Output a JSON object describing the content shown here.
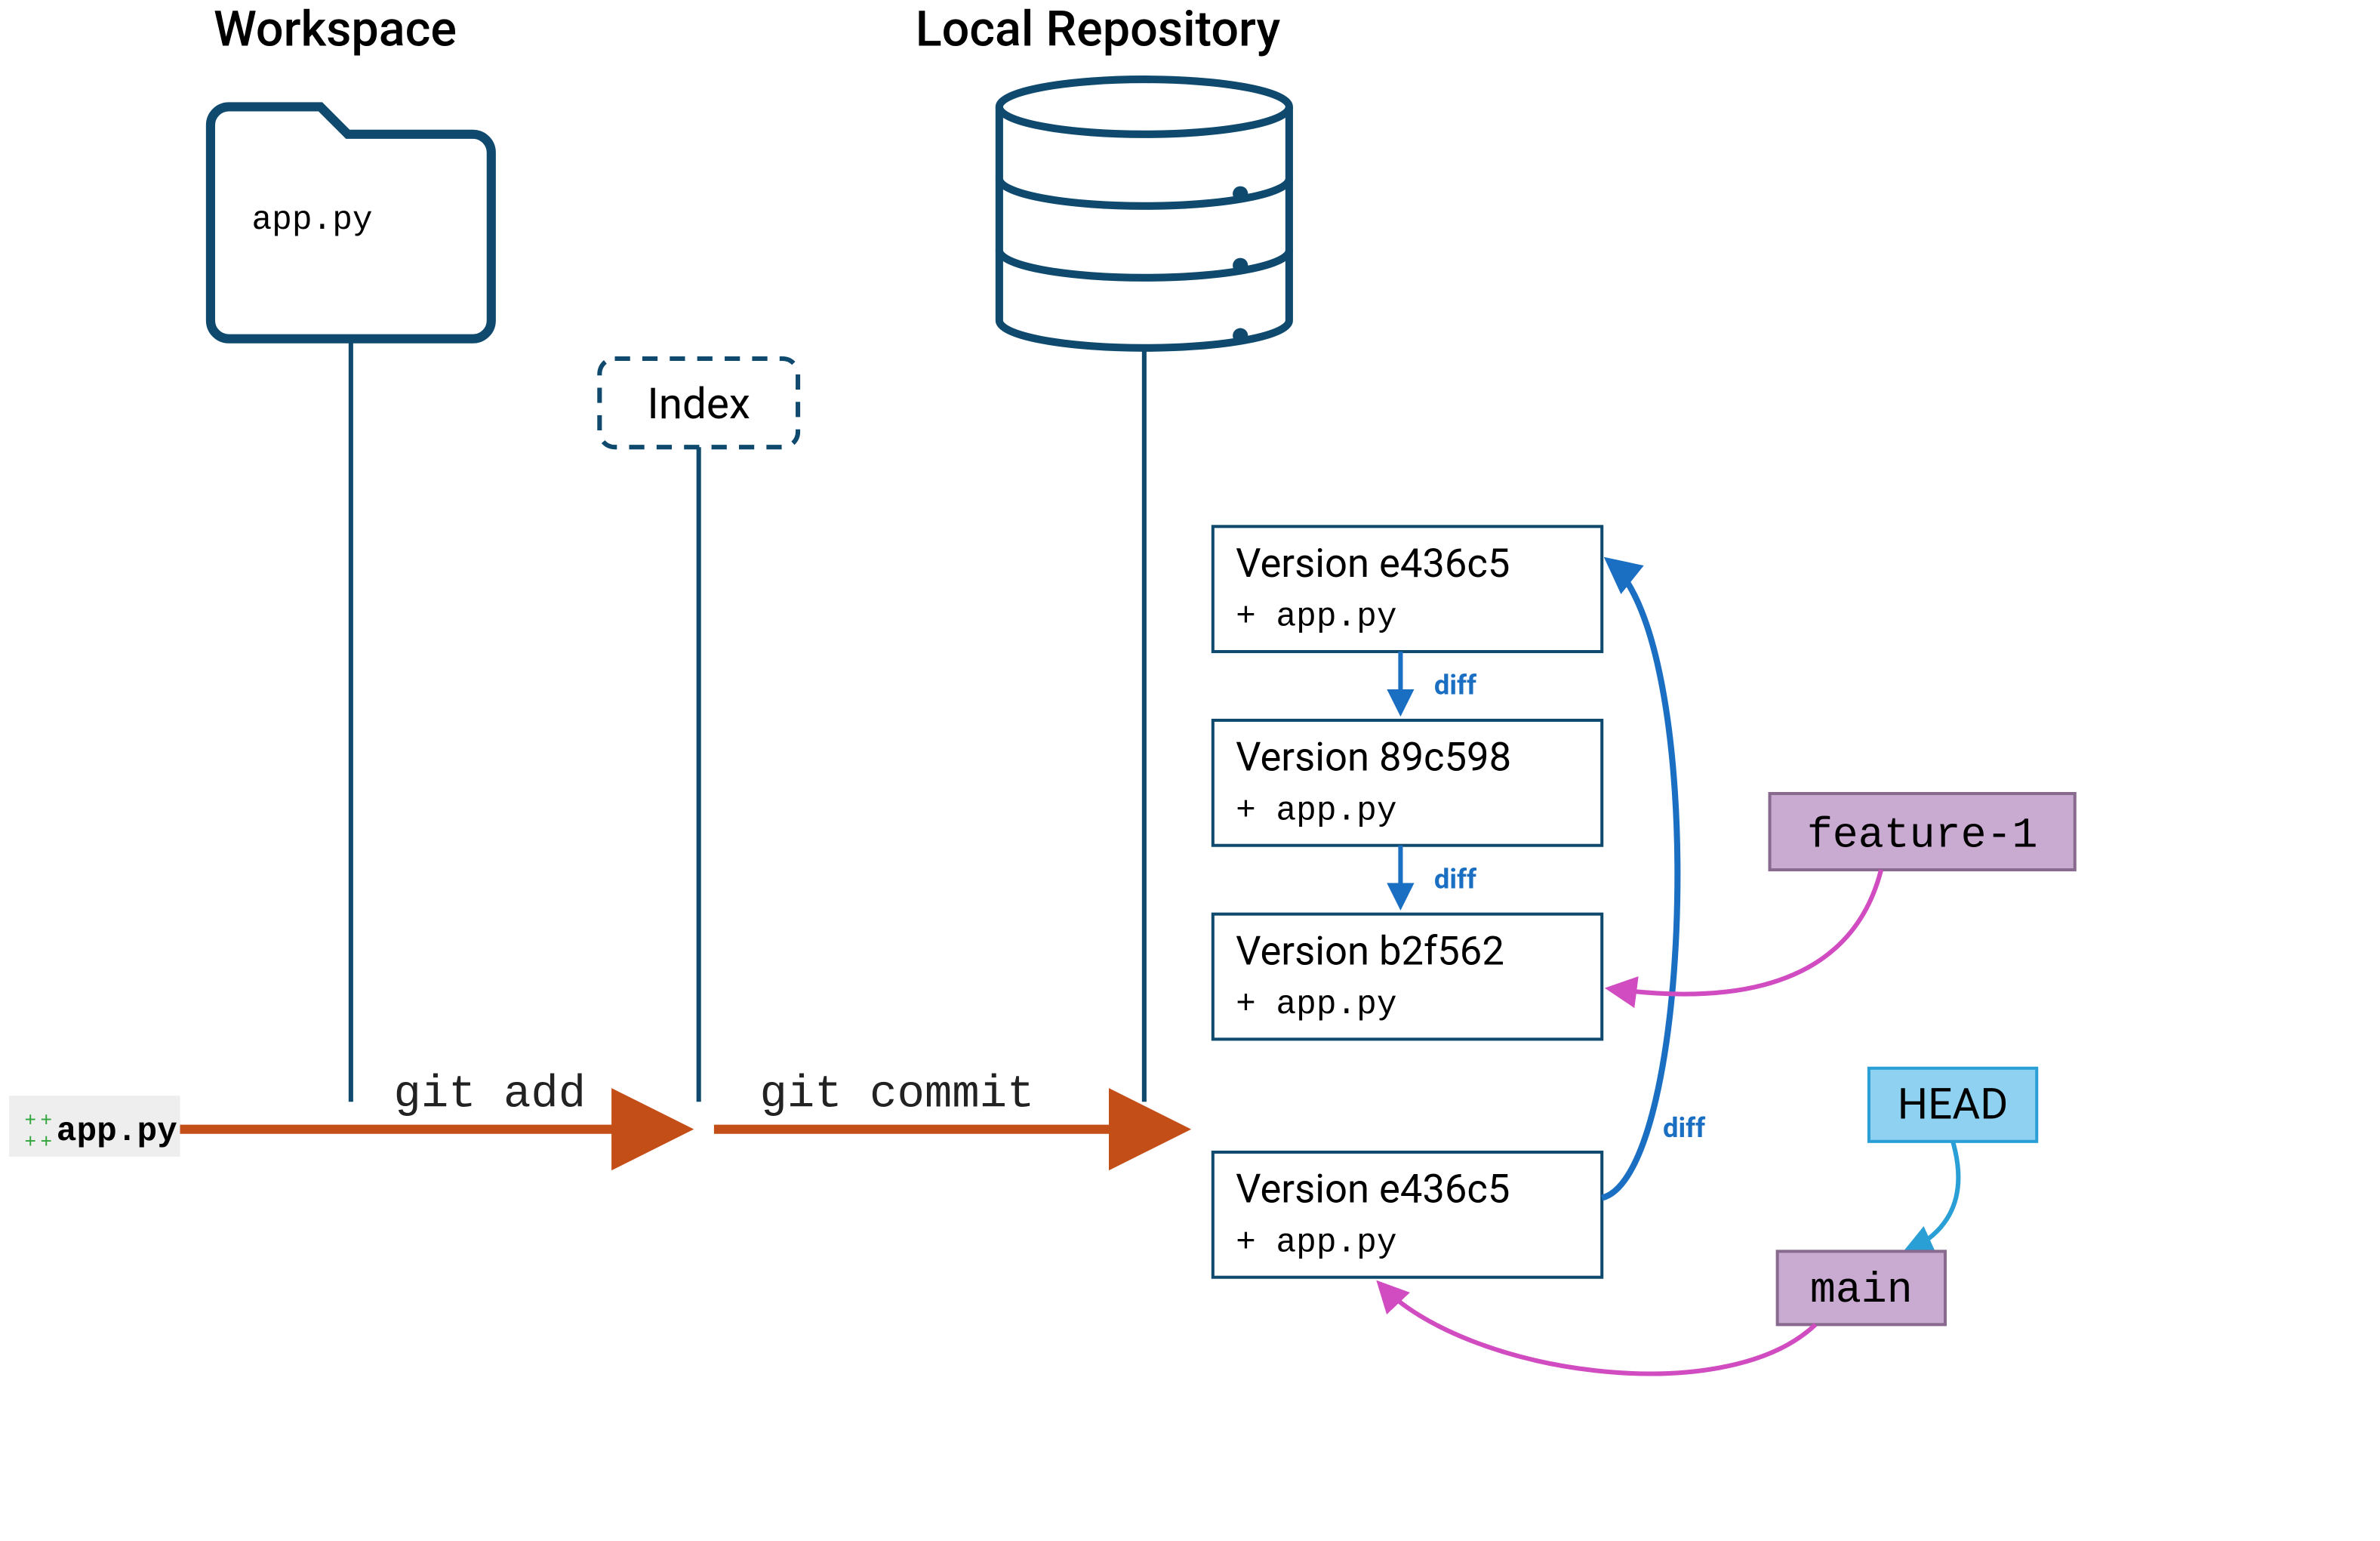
{
  "headings": {
    "workspace": "Workspace",
    "repository": "Local Repository"
  },
  "workspace": {
    "folder_file": "app.py"
  },
  "index": {
    "label": "Index"
  },
  "commands": {
    "git_add": "git add",
    "git_commit": "git commit"
  },
  "changed_file": {
    "name": "app.py",
    "markers": "++++"
  },
  "commits": [
    {
      "title": "Version e436c5",
      "file": "+ app.py"
    },
    {
      "title": "Version 89c598",
      "file": "+ app.py"
    },
    {
      "title": "Version b2f562",
      "file": "+ app.py"
    },
    {
      "title": "Version e436c5",
      "file": "+ app.py"
    }
  ],
  "labels": {
    "diff": "diff",
    "feature_branch": "feature-1",
    "main_branch": "main",
    "head": "HEAD"
  },
  "colors": {
    "navy": "#0f4a6e",
    "blue": "#1b6fc2",
    "orange": "#c44e18",
    "magenta": "#d04cc0",
    "violet_fill": "#c9aad1",
    "violet_stroke": "#886a8f",
    "cyan_fill": "#8fd1f0",
    "cyan_stroke": "#2a9fd6",
    "grey_fill": "#eeeeee",
    "green": "#2fa53a"
  }
}
